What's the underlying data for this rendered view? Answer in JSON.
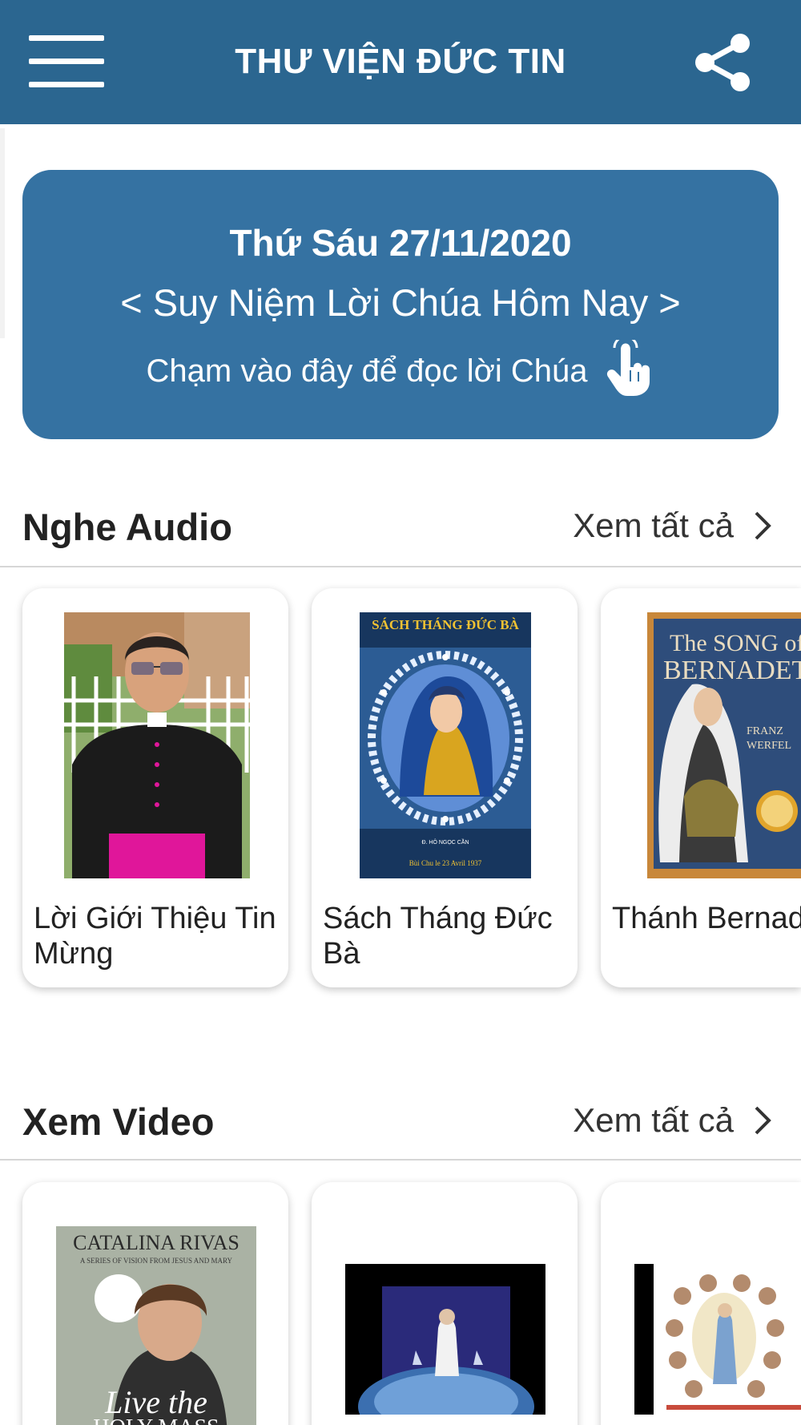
{
  "header": {
    "title": "THƯ VIỆN ĐỨC TIN",
    "menu_icon": "hamburger-menu-icon",
    "share_icon": "share-icon",
    "color": "#2b6690"
  },
  "banner": {
    "date": "Thứ Sáu 27/11/2020",
    "title": "< Suy Niệm Lời Chúa Hôm Nay >",
    "hint": "Chạm vào đây để đọc lời Chúa",
    "hint_icon": "tap-hand-icon",
    "color": "#3572a2"
  },
  "audio": {
    "title": "Nghe Audio",
    "see_all": "Xem tất cả",
    "items": [
      {
        "label": "Lời Giới Thiệu Tin Mừng",
        "thumb": "priest-photo"
      },
      {
        "label": "Sách Tháng Đức Bà",
        "thumb": "book-cover",
        "cover_title": "SÁCH THÁNG ĐỨC BÀ",
        "cover_author": "Đ. HÔ NGỌC CẦN",
        "cover_footer": "Bùi Chu le 23 Avril 1937"
      },
      {
        "label": "Thánh Bernadette Soubirous",
        "thumb": "book-cover",
        "cover_title_1": "The SONG of",
        "cover_title_2": "BERNADETTE",
        "cover_author": "FRANZ WERFEL"
      }
    ]
  },
  "video": {
    "title": "Xem Video",
    "see_all": "Xem tất cả",
    "items": [
      {
        "thumb": "video-cover",
        "cover_title": "CATALINA RIVAS",
        "cover_sub": "A SERIES OF VISION FROM JESUS AND MARY",
        "cover_bottom_1": "Live the",
        "cover_bottom_2": "HOLY MASS"
      },
      {
        "thumb": "video-still"
      },
      {
        "thumb": "video-still"
      }
    ]
  }
}
